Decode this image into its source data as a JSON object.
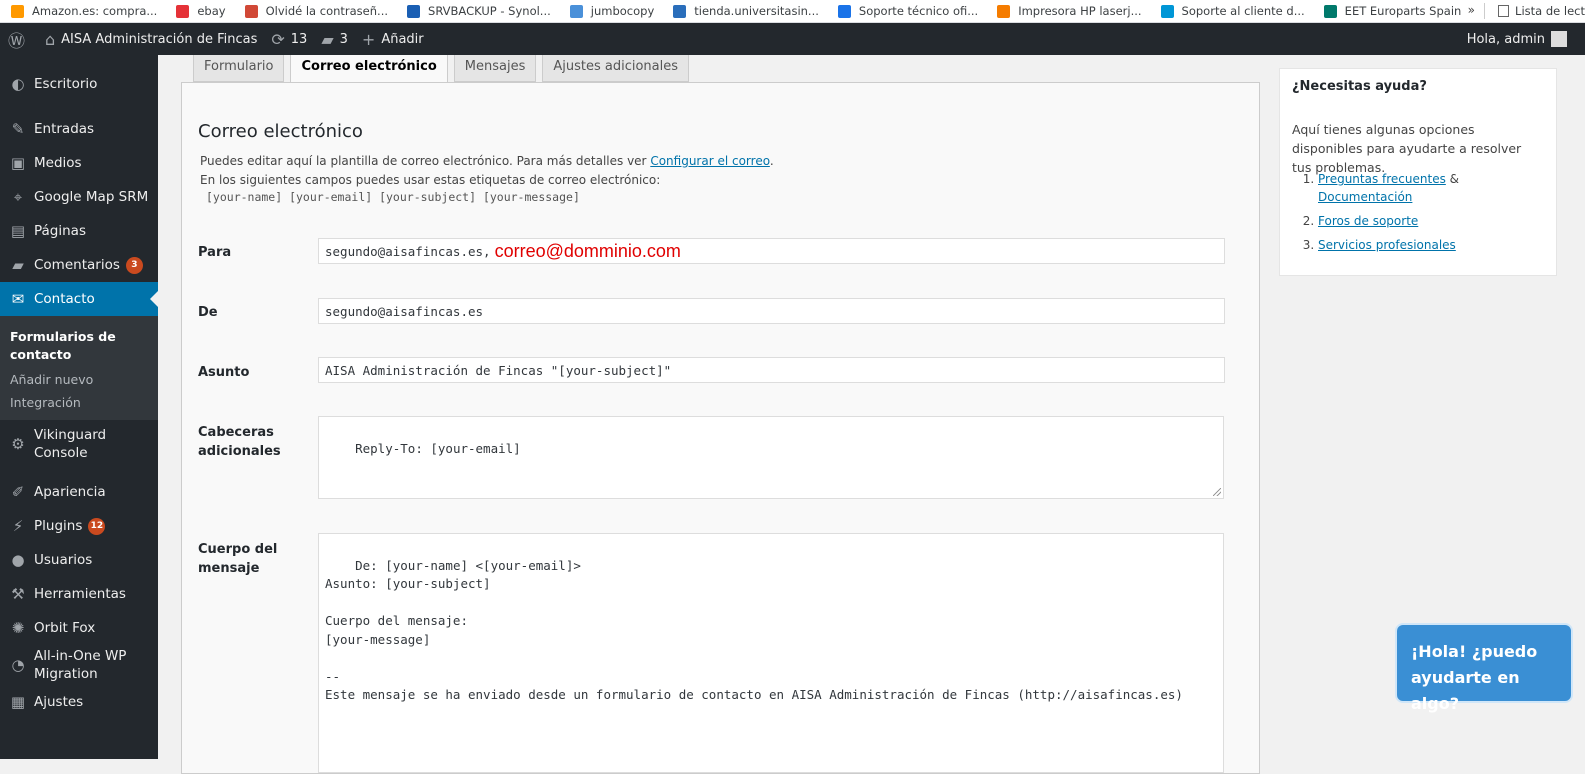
{
  "bookmarks": [
    {
      "label": "Amazon.es: compra...",
      "icon": "amazon-icon",
      "color": "#ff9900"
    },
    {
      "label": "ebay",
      "icon": "ebay-icon",
      "color": "#e53238"
    },
    {
      "label": "Olvidé la contraseñ...",
      "icon": "lock-icon",
      "color": "#d14836"
    },
    {
      "label": "SRVBACKUP - Synol...",
      "icon": "synology-icon",
      "color": "#1a5fb4"
    },
    {
      "label": "jumbocopy",
      "icon": "link-icon",
      "color": "#4a90d9"
    },
    {
      "label": "tienda.universitasin...",
      "icon": "shop-icon",
      "color": "#2a6ebb"
    },
    {
      "label": "Soporte técnico ofi...",
      "icon": "support-icon",
      "color": "#1a73e8"
    },
    {
      "label": "Impresora HP laserj...",
      "icon": "printer-icon",
      "color": "#f57c00"
    },
    {
      "label": "Soporte al cliente d...",
      "icon": "hp-icon",
      "color": "#0096d6"
    },
    {
      "label": "EET Europarts Spain",
      "icon": "eet-icon",
      "color": "#00796b"
    }
  ],
  "bookmarks_more": "»",
  "reading_list": "Lista de lect",
  "adminbar": {
    "site_name": "AISA Administración de Fincas",
    "updates": "13",
    "comments": "3",
    "add_new": "Añadir",
    "greeting": "Hola, admin"
  },
  "sidebar": {
    "items": [
      {
        "label": "Escritorio",
        "icon": "dashboard-icon",
        "glyph": "◐"
      },
      {
        "label": "Entradas",
        "icon": "pin-icon",
        "glyph": "✎"
      },
      {
        "label": "Medios",
        "icon": "media-icon",
        "glyph": "▣"
      },
      {
        "label": "Google Map SRM",
        "icon": "location-icon",
        "glyph": "⌖"
      },
      {
        "label": "Páginas",
        "icon": "pages-icon",
        "glyph": "▤"
      },
      {
        "label": "Comentarios",
        "icon": "comments-icon",
        "glyph": "▰",
        "badge": "3"
      },
      {
        "label": "Contacto",
        "icon": "mail-icon",
        "glyph": "✉"
      }
    ],
    "submenu": [
      "Formularios de contacto",
      "Añadir nuevo",
      "Integración"
    ],
    "items_after": [
      {
        "label": "Vikinguard Console",
        "icon": "gear-icon",
        "glyph": "⚙"
      },
      {
        "label": "Apariencia",
        "icon": "brush-icon",
        "glyph": "✐"
      },
      {
        "label": "Plugins",
        "icon": "plugin-icon",
        "glyph": "⚡",
        "badge": "12"
      },
      {
        "label": "Usuarios",
        "icon": "user-icon",
        "glyph": "●"
      },
      {
        "label": "Herramientas",
        "icon": "wrench-icon",
        "glyph": "⚒"
      },
      {
        "label": "Orbit Fox",
        "icon": "fox-icon",
        "glyph": "✺"
      },
      {
        "label": "All-in-One WP Migration",
        "icon": "migration-icon",
        "glyph": "◔"
      },
      {
        "label": "Ajustes",
        "icon": "settings-icon",
        "glyph": "▦"
      }
    ]
  },
  "tabs": [
    "Formulario",
    "Correo electrónico",
    "Mensajes",
    "Ajustes adicionales"
  ],
  "panel": {
    "title": "Correo electrónico",
    "desc_line1": "Puedes editar aquí la plantilla de correo electrónico. Para más detalles ver ",
    "desc_link": "Configurar el correo",
    "desc_line1_end": ".",
    "desc_line2": "En los siguientes campos puedes usar estas etiquetas de correo electrónico:",
    "tags": "[your-name] [your-email] [your-subject] [your-message]"
  },
  "fields": {
    "to_label": "Para",
    "to_value": "segundo@aisafincas.es,",
    "to_annotation": "correo@domminio.com",
    "from_label": "De",
    "from_value": "segundo@aisafincas.es",
    "subject_label": "Asunto",
    "subject_value": "AISA Administración de Fincas \"[your-subject]\"",
    "headers_label_1": "Cabeceras",
    "headers_label_2": "adicionales",
    "headers_value": "Reply-To: [your-email]",
    "body_label_1": "Cuerpo del",
    "body_label_2": "mensaje",
    "body_value": "De: [your-name] <[your-email]>\nAsunto: [your-subject]\n\nCuerpo del mensaje:\n[your-message]\n\n--\nEste mensaje se ha enviado desde un formulario de contacto en AISA Administración de Fincas (http://aisafincas.es)"
  },
  "help": {
    "title": "¿Necesitas ayuda?",
    "text": "Aquí tienes algunas opciones disponibles para ayudarte a resolver tus problemas.",
    "faq": "Preguntas frecuentes",
    "amp": " & ",
    "docs": "Documentación",
    "forums": "Foros de soporte",
    "services": "Servicios profesionales"
  },
  "chat": {
    "line1": "¡Hola! ¿puedo",
    "line2": "ayudarte en algo?"
  }
}
